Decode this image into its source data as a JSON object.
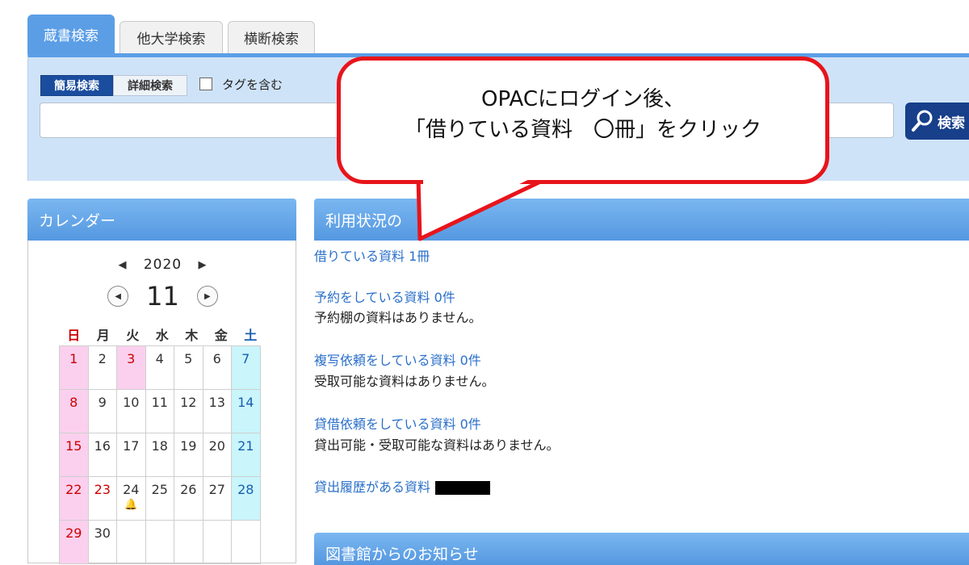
{
  "tabs": [
    {
      "label": "蔵書検索",
      "active": true
    },
    {
      "label": "他大学検索",
      "active": false
    },
    {
      "label": "横断検索",
      "active": false
    }
  ],
  "search": {
    "mode_simple": "簡易検索",
    "mode_detail": "詳細検索",
    "tag_label": "タグを含む",
    "button_label": "検索",
    "query": ""
  },
  "calendar": {
    "title": "カレンダー",
    "year": "2020",
    "month": "11",
    "weekdays": [
      "日",
      "月",
      "火",
      "水",
      "木",
      "金",
      "土"
    ],
    "weeks": [
      [
        "1",
        "2",
        "3",
        "4",
        "5",
        "6",
        "7"
      ],
      [
        "8",
        "9",
        "10",
        "11",
        "12",
        "13",
        "14"
      ],
      [
        "15",
        "16",
        "17",
        "18",
        "19",
        "20",
        "21"
      ],
      [
        "22",
        "23",
        "24",
        "25",
        "26",
        "27",
        "28"
      ],
      [
        "29",
        "30",
        "",
        "",
        "",
        "",
        ""
      ]
    ]
  },
  "status": {
    "title": "利用状況の",
    "borrowed_link": "借りている資料 1冊",
    "reserved_link": "予約をしている資料 0件",
    "reserved_note": "予約棚の資料はありません。",
    "copy_link": "複写依頼をしている資料 0件",
    "copy_note": "受取可能な資料はありません。",
    "loan_req_link": "貸借依頼をしている資料 0件",
    "loan_req_note": "貸出可能・受取可能な資料はありません。",
    "history_link": "貸出履歴がある資料"
  },
  "notice": {
    "title": "図書館からのお知らせ"
  },
  "callout": {
    "line1": "OPACにログイン後、",
    "line2": "「借りている資料　〇冊」をクリック"
  },
  "colors": {
    "tab_active": "#5b9ee6",
    "panel_bg": "#cfe3f8",
    "mode_active": "#1a4d9e",
    "search_button": "#173f8a",
    "link": "#2a6fc9",
    "callout_border": "#e8141b",
    "holiday": "#fbd0ee",
    "saturday": "#c9f5fb"
  }
}
